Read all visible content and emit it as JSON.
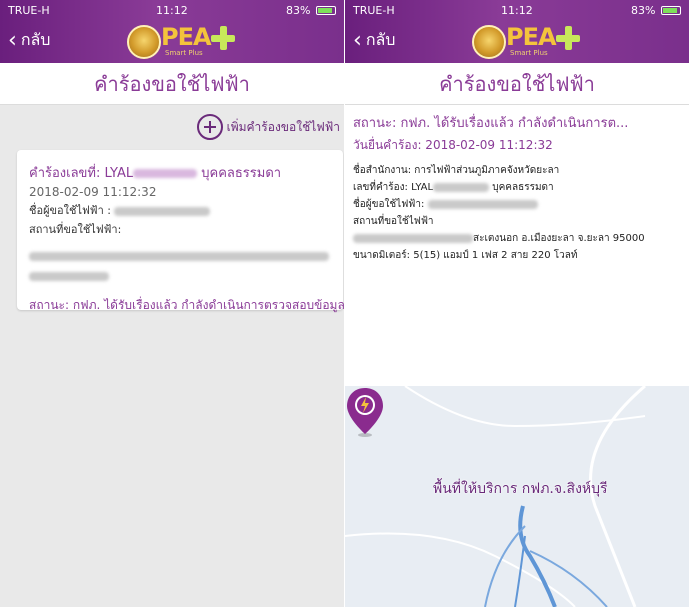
{
  "status_bar": {
    "carrier": "TRUE-H",
    "time": "11:12",
    "battery": "83%"
  },
  "nav": {
    "back_label": "กลับ",
    "logo_text": "PEA",
    "logo_sub": "Smart Plus"
  },
  "page_title": "คำร้องขอใช้ไฟฟ้า",
  "list_screen": {
    "add_request_label": "เพิ่มคำร้องขอใช้ไฟฟ้า",
    "card": {
      "request_no_label": "คำร้องเลขที่: LYAL",
      "request_no_suffix": "บุคคลธรรมดา",
      "datetime": "2018-02-09 11:12:32",
      "requester_label": "ชื่อผู้ขอใช้ไฟฟ้า :",
      "location_label": "สถานที่ขอใช้ไฟฟ้า:",
      "status_text": "สถานะ: กฟภ. ได้รับเรื่องแล้ว กำลังดำเนินการตรวจสอบข้อมูล"
    }
  },
  "detail_screen": {
    "status_text": "สถานะ: กฟภ. ได้รับเรื่องแล้ว กำลังดำเนินการต...",
    "submit_date": "วันยื่นคำร้อง: 2018-02-09 11:12:32",
    "office": "ชื่อสำนักงาน: การไฟฟ้าส่วนภูมิภาคจังหวัดยะลา",
    "request_no_label": "เลขที่คำร้อง: LYAL",
    "request_no_suffix": "บุคคลธรรมดา",
    "requester_label": "ชื่อผู้ขอใช้ไฟฟ้า:",
    "location_label": "สถานที่ขอใช้ไฟฟ้า",
    "address_suffix": "สะเตงนอก อ.เมืองยะลา จ.ยะลา 95000",
    "meter_info": "ขนาดมิเตอร์: 5(15) แอมป์ 1 เฟส 2 สาย 220 โวลท์",
    "map_label": "พื้นที่ให้บริการ กฟภ.จ.สิงห์บุรี"
  },
  "colors": {
    "brand_purple": "#8a3b97",
    "header_purple": "#6a1f7d",
    "logo_gold": "#f4c33c"
  }
}
